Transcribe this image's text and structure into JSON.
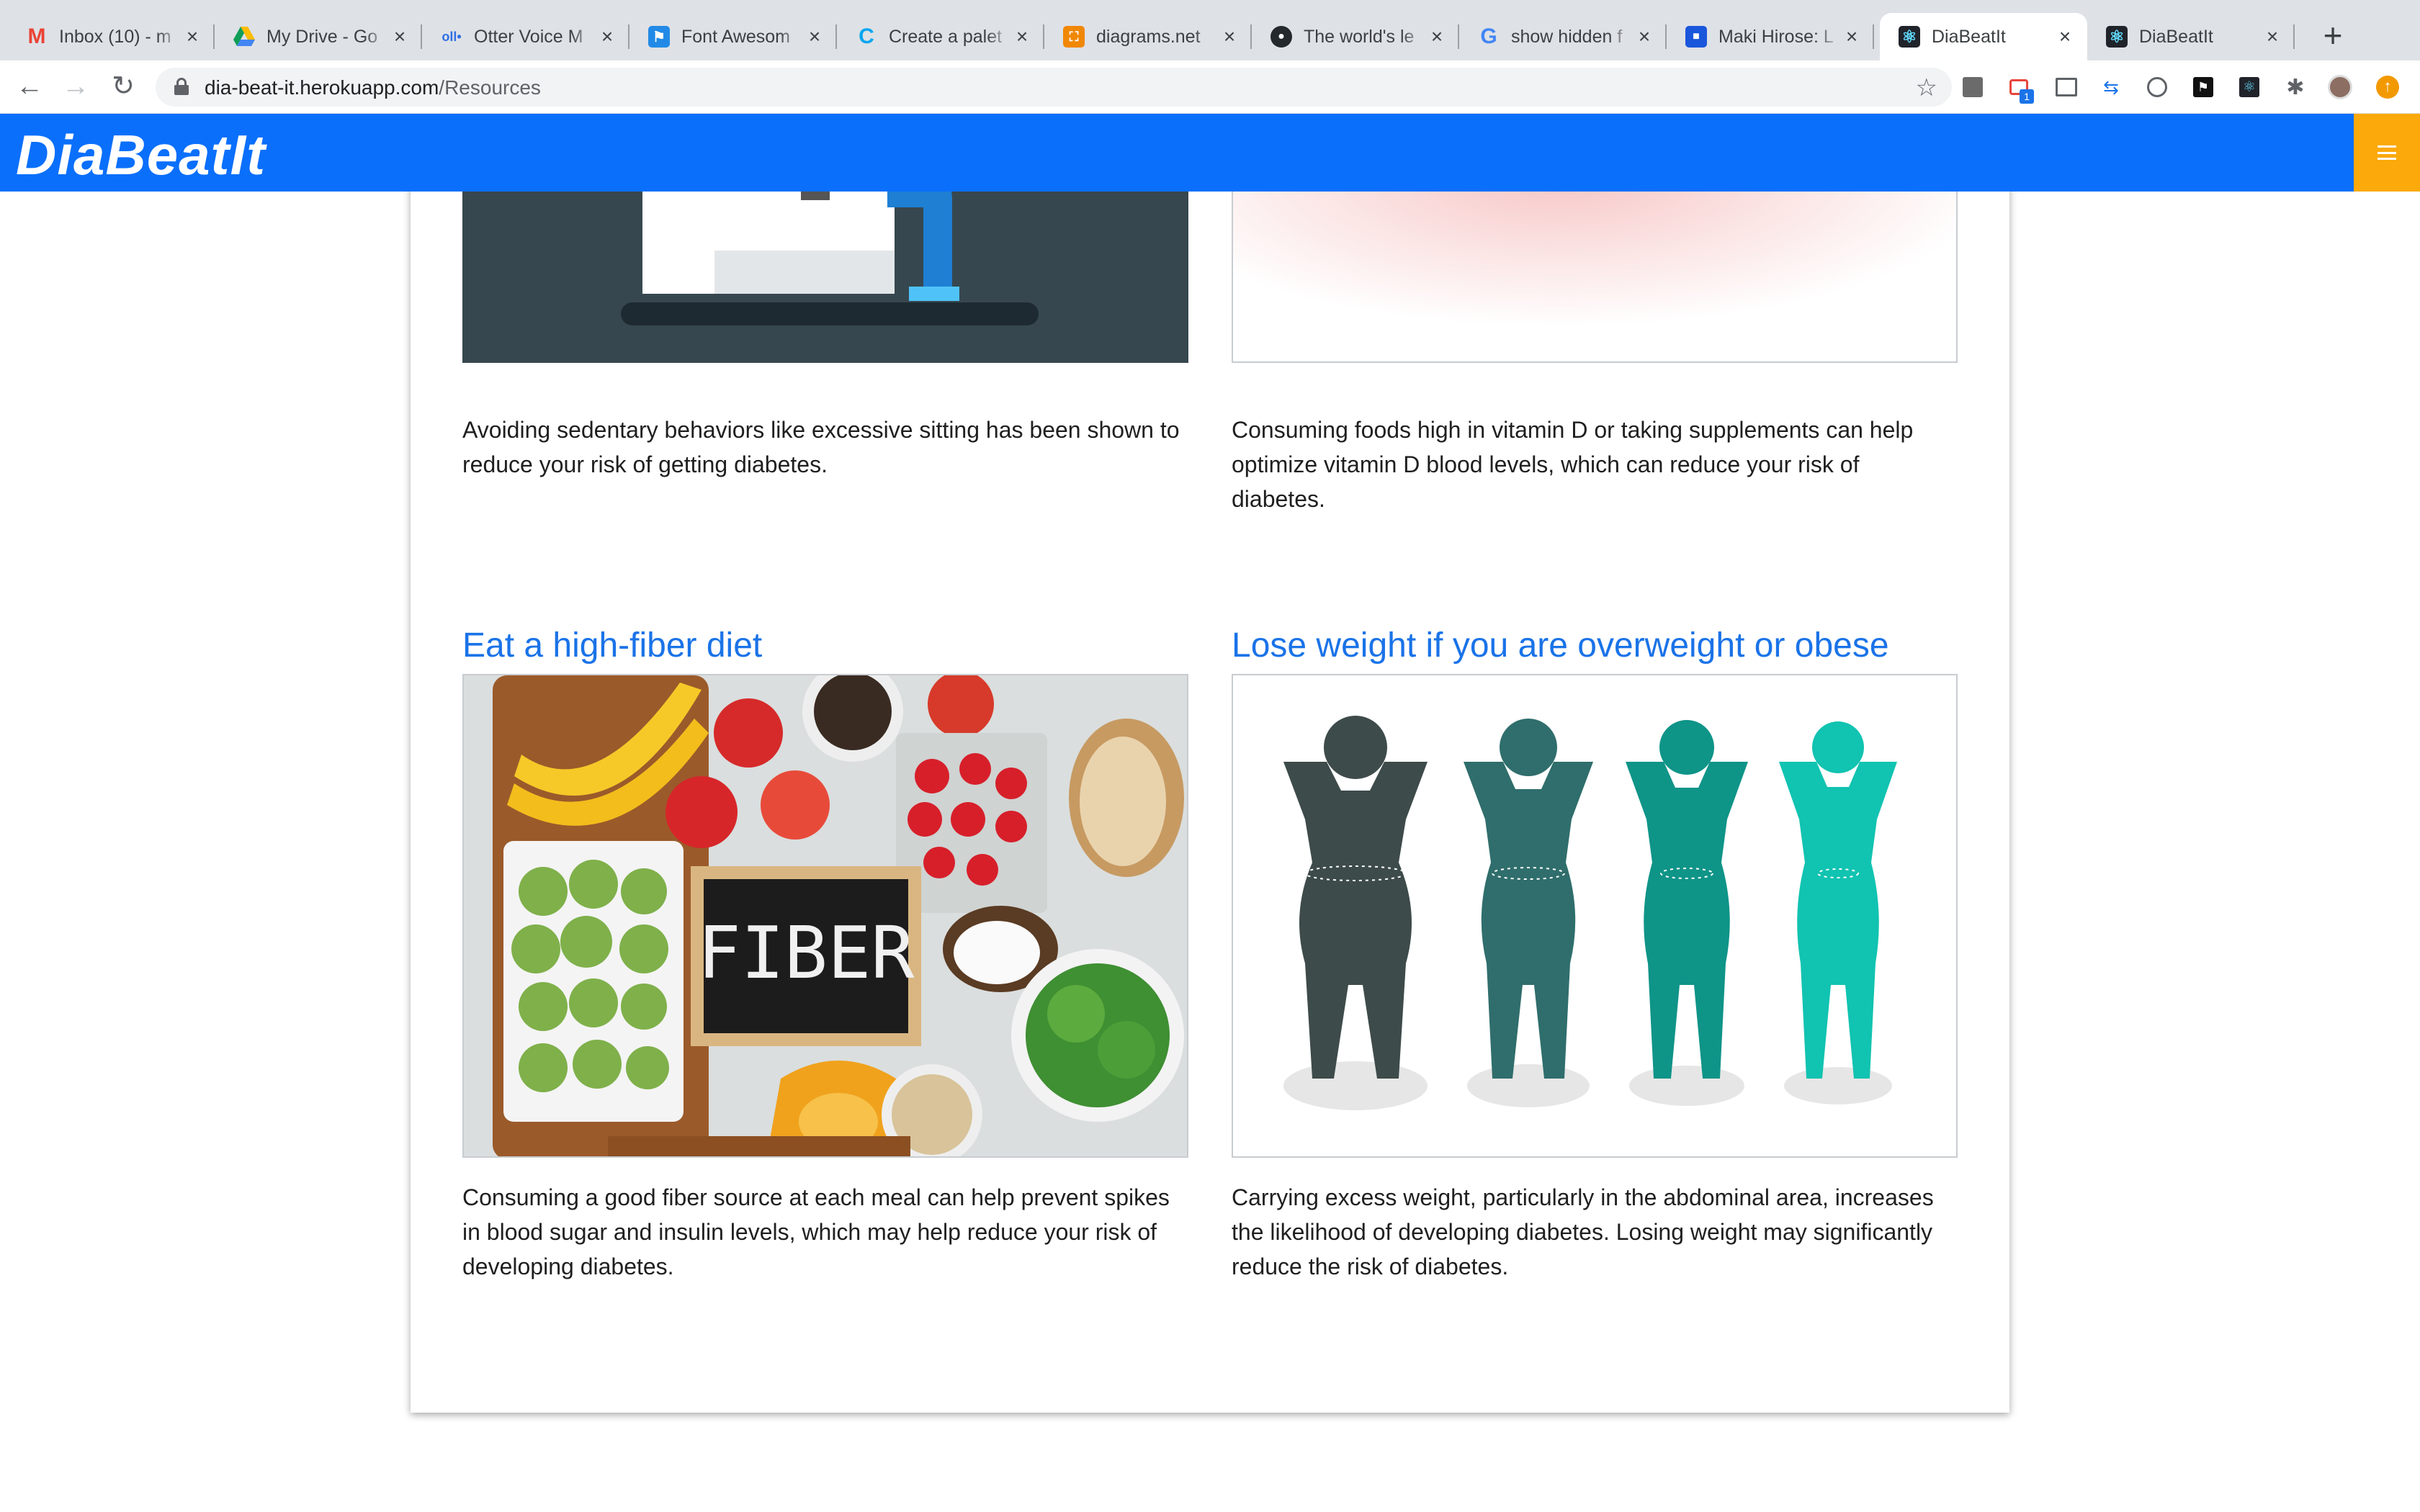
{
  "browser": {
    "tabs": [
      {
        "title": "Inbox (10) - m",
        "icon": "gmail-icon",
        "color": "#ea4335",
        "glyph": "M"
      },
      {
        "title": "My Drive - Go",
        "icon": "google-drive-icon",
        "color": "#34a853",
        "glyph": "▲"
      },
      {
        "title": "Otter Voice M",
        "icon": "otter-icon",
        "color": "#2f6fe4",
        "glyph": "o"
      },
      {
        "title": "Font Awesom",
        "icon": "font-awesome-flag-icon",
        "color": "#228ae6",
        "glyph": "⚑"
      },
      {
        "title": "Create a palet",
        "icon": "coolors-icon",
        "color": "#0aa6ef",
        "glyph": "c"
      },
      {
        "title": "diagrams.net",
        "icon": "diagrams-icon",
        "color": "#f08705",
        "glyph": "◆"
      },
      {
        "title": "The world's le",
        "icon": "github-icon",
        "color": "#24292e",
        "glyph": "●"
      },
      {
        "title": "show hidden f",
        "icon": "google-icon",
        "color": "#4285f4",
        "glyph": "G"
      },
      {
        "title": "Maki Hirose: L",
        "icon": "trello-icon",
        "color": "#1a56db",
        "glyph": "■"
      },
      {
        "title": "DiaBeatIt",
        "icon": "react-icon",
        "color": "#20232a",
        "glyph": "⚛",
        "active": true
      },
      {
        "title": "DiaBeatIt",
        "icon": "react-icon",
        "color": "#20232a",
        "glyph": "⚛"
      }
    ],
    "url_host": "dia-beat-it.herokuapp.com",
    "url_path": "/Resources"
  },
  "app": {
    "brand": "DiaBeatIt",
    "colors": {
      "primary": "#0a6ffb",
      "accent": "#fba90b",
      "link": "#1a73e8"
    }
  },
  "tips_top": [
    {
      "text": "Avoiding sedentary behaviors like excessive sitting has been shown to reduce your risk of getting diabetes."
    },
    {
      "text": "Consuming foods high in vitamin D or taking supplements can help optimize vitamin D blood levels, which can reduce your risk of diabetes."
    }
  ],
  "tips_bottom": [
    {
      "title": "Eat a high-fiber diet",
      "image_label": "FIBER",
      "text": "Consuming a good fiber source at each meal can help prevent spikes in blood sugar and insulin levels, which may help reduce your risk of developing diabetes."
    },
    {
      "title": "Lose weight if you are overweight or obese",
      "text": "Carrying excess weight, particularly in the abdominal area, increases the likelihood of developing diabetes. Losing weight may significantly reduce the risk of diabetes."
    }
  ]
}
